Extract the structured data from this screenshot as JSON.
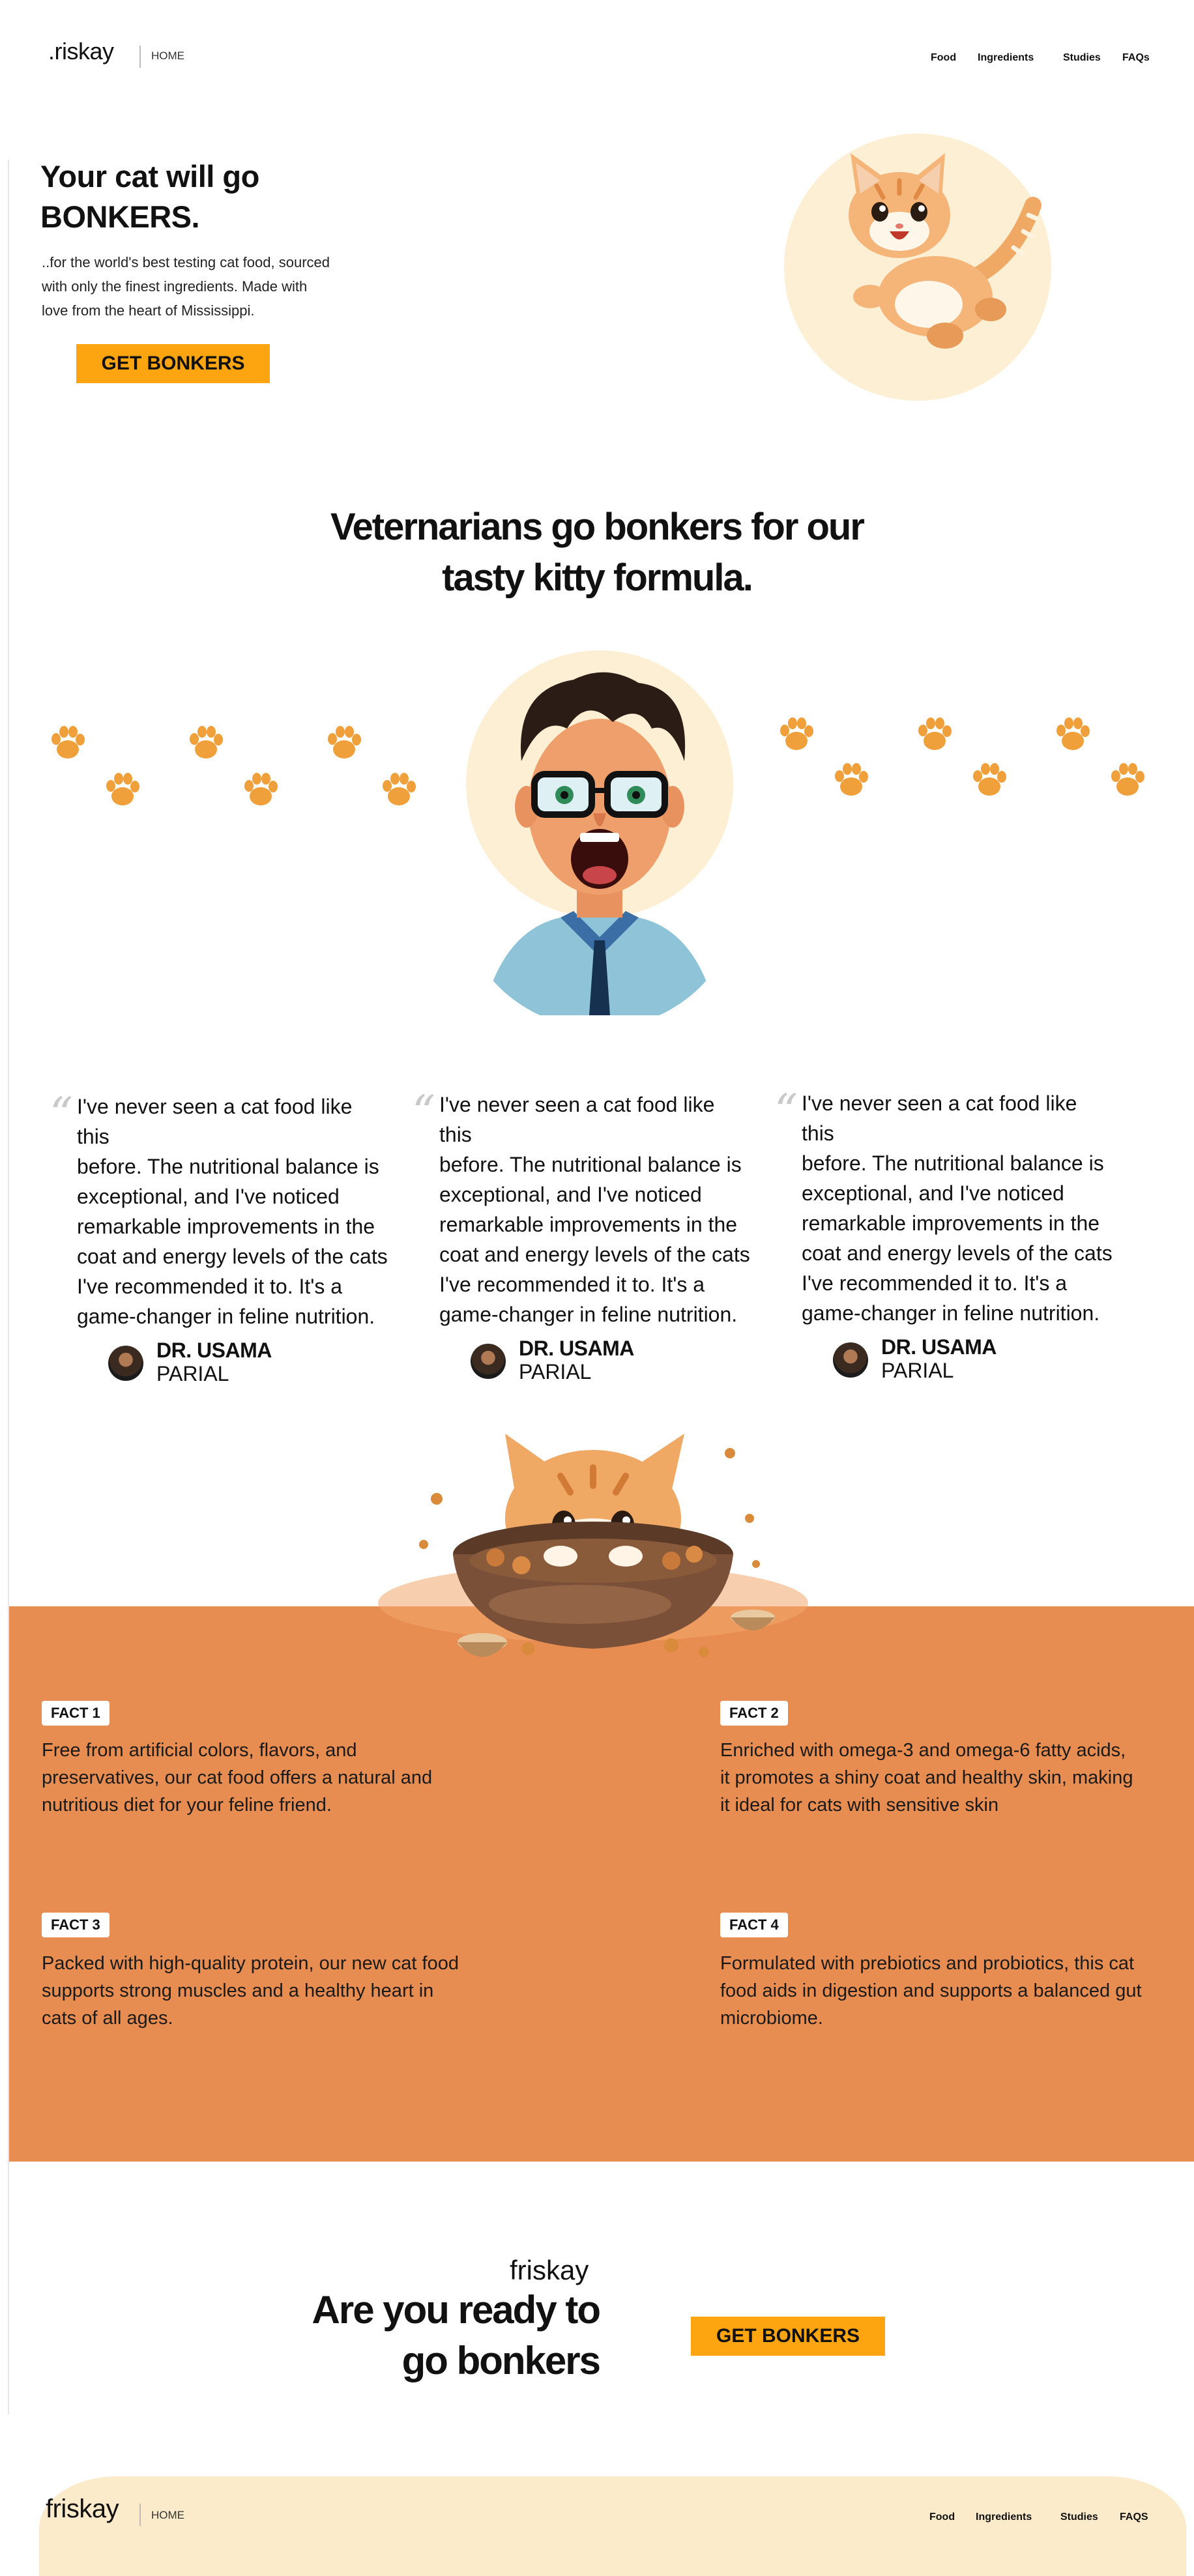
{
  "header": {
    "logo": ".riskay",
    "home": "HOME",
    "nav": [
      "Food",
      "Ingredients",
      "Studies",
      "FAQs"
    ]
  },
  "hero": {
    "title_line1": "Your cat will go",
    "title_line2": "BONKERS.",
    "subtitle_line1": "..for the world's best testing cat food, sourced",
    "subtitle_line2": "with only the finest ingredients. Made with",
    "subtitle_line3": "love from the heart of Mississippi.",
    "cta": "GET BONKERS"
  },
  "vets": {
    "title_line1": "Veternarians go bonkers for our",
    "title_line2": "tasty kitty formula."
  },
  "testimonials": [
    {
      "lines": [
        "I've never seen a cat food like this",
        "before. The nutritional balance is",
        "exceptional, and I've noticed",
        "remarkable improvements in the",
        "coat and energy levels of the cats",
        "I've recommended it to. It's a",
        "game-changer in feline nutrition."
      ],
      "name_first": "DR. USAMA",
      "name_last": "PARIAL"
    },
    {
      "lines": [
        "I've never seen a cat food like this",
        "before. The nutritional balance is",
        "exceptional, and I've noticed",
        "remarkable improvements in the",
        "coat and energy levels of the cats",
        "I've recommended it to. It's a",
        "game-changer in feline nutrition."
      ],
      "name_first": "DR. USAMA",
      "name_last": "PARIAL"
    },
    {
      "lines": [
        "I've never seen a cat food like this",
        "before. The nutritional balance is",
        "exceptional, and I've noticed",
        "remarkable improvements in the",
        "coat and energy levels of the cats",
        "I've recommended it to. It's a",
        "game-changer in feline nutrition."
      ],
      "name_first": "DR. USAMA",
      "name_last": "PARIAL"
    }
  ],
  "facts": [
    {
      "tag": "FACT 1",
      "lines": [
        "Free from artificial colors, flavors, and",
        "preservatives, our cat food offers a natural and",
        "nutritious diet for your feline friend."
      ]
    },
    {
      "tag": "FACT 2",
      "lines": [
        "Enriched with omega-3 and omega-6 fatty acids,",
        "it promotes a shiny coat and healthy skin, making",
        "it ideal for cats with sensitive skin"
      ]
    },
    {
      "tag": "FACT 3",
      "lines": [
        "Packed with high-quality protein, our new cat food",
        "supports strong muscles and a healthy heart in",
        "cats of all ages."
      ]
    },
    {
      "tag": "FACT 4",
      "lines": [
        "Formulated with prebiotics and probiotics, this cat",
        "food aids in digestion and supports a balanced gut",
        "microbiome."
      ]
    }
  ],
  "cta_section": {
    "logo": "friskay",
    "title_line1": "Are you ready to",
    "title_line2": "go bonkers",
    "cta": "GET BONKERS"
  },
  "footer": {
    "logo": "friskay",
    "home": "HOME",
    "nav": [
      "Food",
      "Ingredients",
      "Studies",
      "FAQS"
    ]
  },
  "colors": {
    "accent": "#FCA511",
    "facts_bg": "#E88D52",
    "footer_bg": "#FCEBCB",
    "circle_bg": "#FDEFD3"
  }
}
